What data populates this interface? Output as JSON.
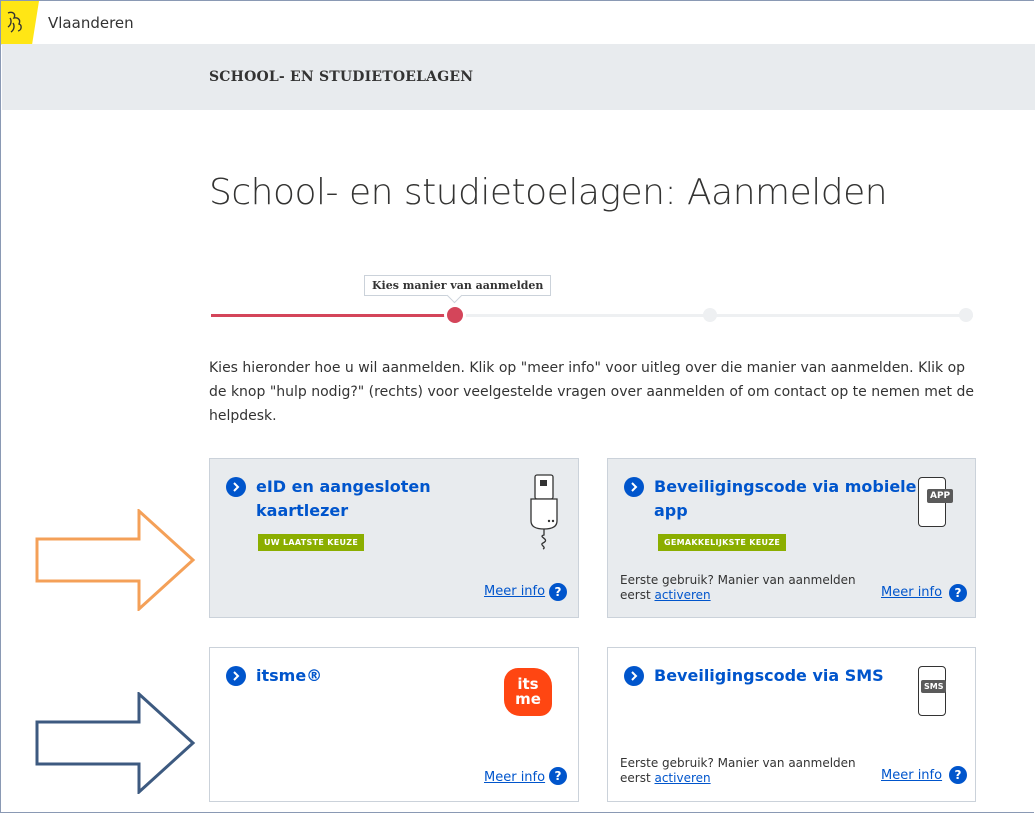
{
  "header": {
    "brand": "Vlaanderen"
  },
  "subheader": {
    "title": "SCHOOL- EN STUDIETOELAGEN"
  },
  "page": {
    "title": "School- en studietoelagen: Aanmelden",
    "step_tooltip": "Kies manier van aanmelden",
    "intro": "Kies hieronder hoe u wil aanmelden. Klik op \"meer info\" voor uitleg over die manier van aanmelden. Klik op de knop \"hulp nodig?\" (rechts) voor veelgestelde vragen over aanmelden of om contact op te nemen met de helpdesk."
  },
  "progress": {
    "steps": 4,
    "current": 2
  },
  "cards": {
    "eid": {
      "title_line1": "eID en aangesloten",
      "title_line2": "kaartlezer",
      "badge": "UW LAATSTE KEUZE",
      "meer_info": "Meer info",
      "help": "?"
    },
    "app": {
      "title_line1": "Beveiligingscode via mobiele",
      "title_line2": "app",
      "badge": "GEMAKKELIJKSTE KEUZE",
      "icon_text": "APP",
      "note_line1": "Eerste gebruik? Manier van aanmelden",
      "note_prefix": "eerst ",
      "note_link": "activeren",
      "meer_info": "Meer info",
      "help": "?"
    },
    "itsme": {
      "title": "itsme®",
      "logo_line1": "its",
      "logo_line2": "me",
      "meer_info": "Meer info",
      "help": "?"
    },
    "sms": {
      "title": "Beveiligingscode via SMS",
      "icon_text": "SMS",
      "note_line1": "Eerste gebruik? Manier van aanmelden",
      "note_prefix": "eerst ",
      "note_link": "activeren",
      "meer_info": "Meer info",
      "help": "?"
    }
  },
  "colors": {
    "accent": "#0055cc",
    "progress": "#d4455a",
    "badge": "#8bae00",
    "arrow_orange": "#f4a058",
    "arrow_blue": "#3d5a80",
    "logo_yellow": "#ffe615",
    "itsme_red": "#ff4612"
  }
}
